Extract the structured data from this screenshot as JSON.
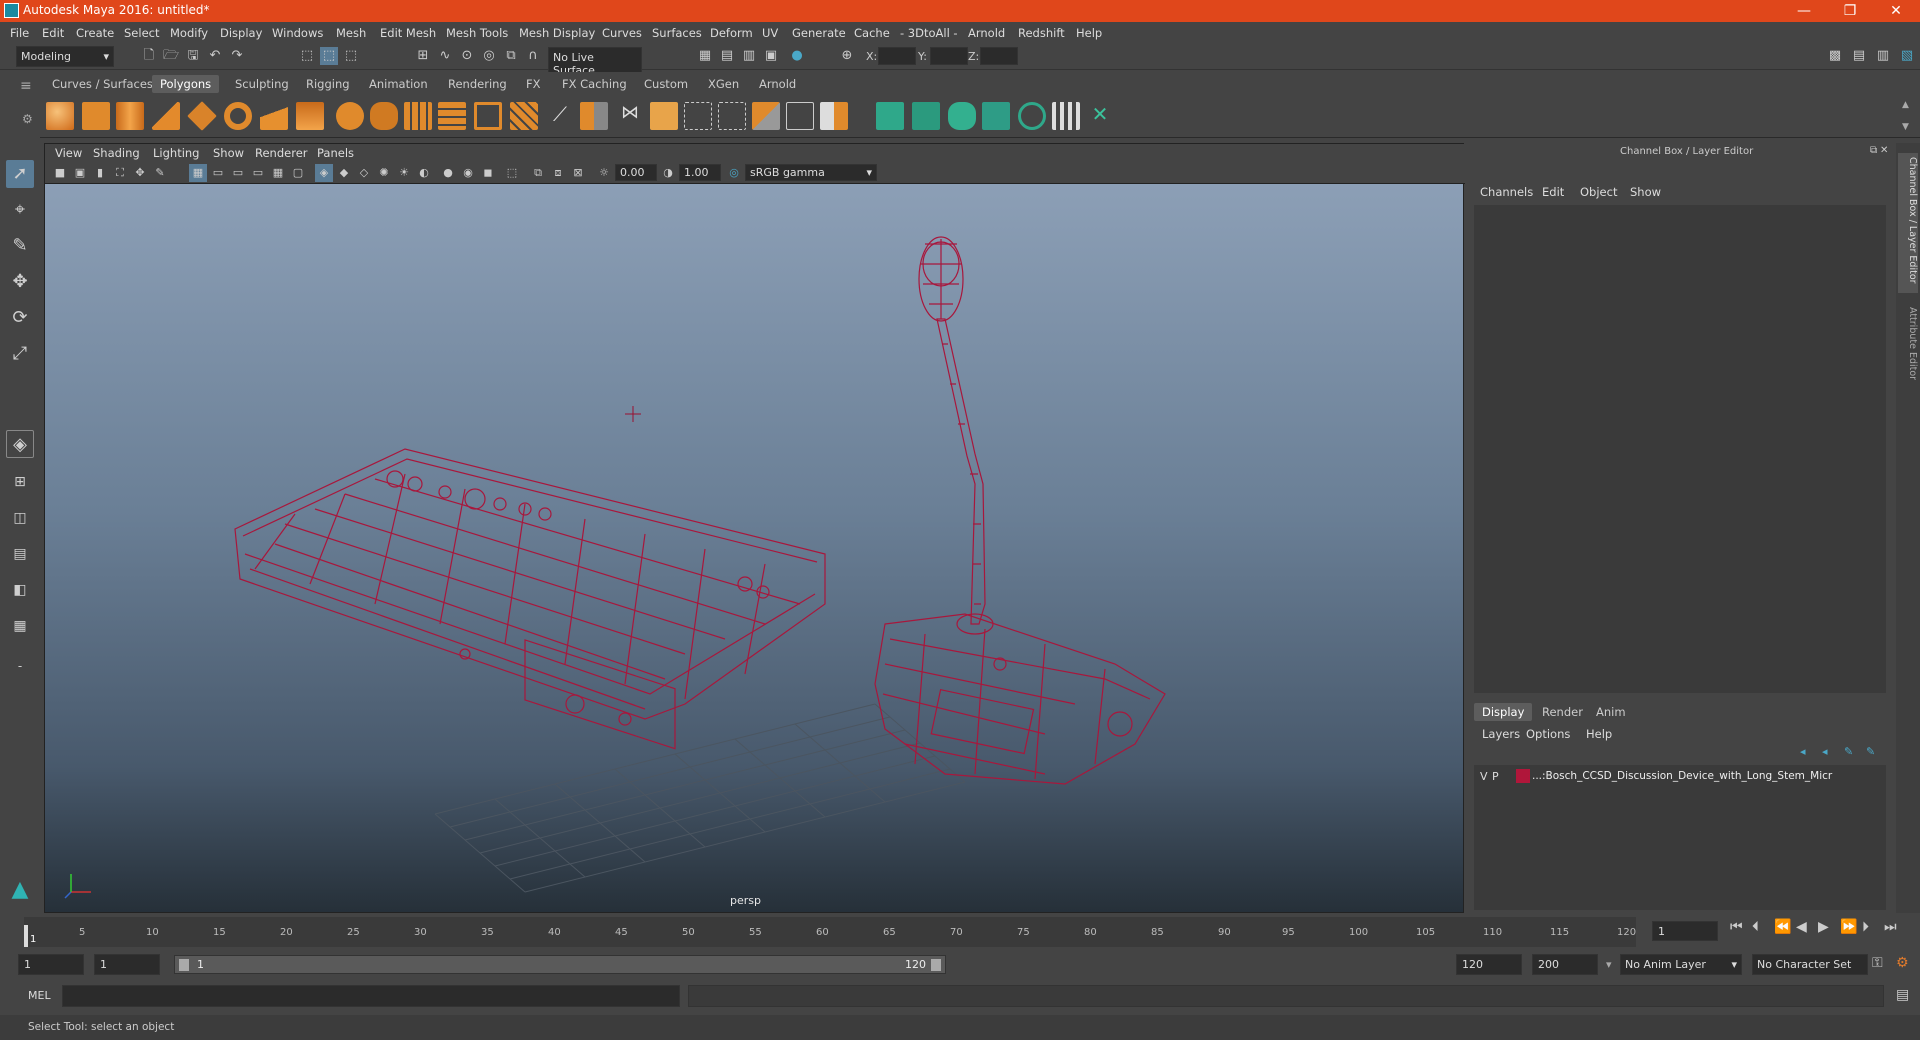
{
  "window": {
    "title": "Autodesk Maya 2016: untitled*",
    "minimize": "—",
    "maximize": "❐",
    "close": "✕"
  },
  "menu": [
    "File",
    "Edit",
    "Create",
    "Select",
    "Modify",
    "Display",
    "Windows",
    "Mesh",
    "Edit Mesh",
    "Mesh Tools",
    "Mesh Display",
    "Curves",
    "Surfaces",
    "Deform",
    "UV",
    "Generate",
    "Cache",
    "- 3DtoAll -",
    "Arnold",
    "Redshift",
    "Help"
  ],
  "status": {
    "mode": "Modeling",
    "live_surface": "No Live Surface",
    "x_label": "X:",
    "y_label": "Y:",
    "z_label": "Z:"
  },
  "shelf_tabs": [
    "Curves / Surfaces",
    "Polygons",
    "Sculpting",
    "Rigging",
    "Animation",
    "Rendering",
    "FX",
    "FX Caching",
    "Custom",
    "XGen",
    "Arnold"
  ],
  "shelf_active": "Polygons",
  "viewport": {
    "menu": [
      "View",
      "Shading",
      "Lighting",
      "Show",
      "Renderer",
      "Panels"
    ],
    "exposure": "0.00",
    "gamma": "1.00",
    "color_space": "sRGB gamma",
    "camera": "persp"
  },
  "channel_box": {
    "title": "Channel Box / Layer Editor",
    "menu": [
      "Channels",
      "Edit",
      "Object",
      "Show"
    ],
    "tabs": [
      "Display",
      "Render",
      "Anim"
    ],
    "active_tab": "Display",
    "layer_menu": [
      "Layers",
      "Options",
      "Help"
    ],
    "layer": {
      "v": "V",
      "p": "P",
      "name": "...:Bosch_CCSD_Discussion_Device_with_Long_Stem_Micr",
      "color": "#b0163a"
    }
  },
  "side_tabs": [
    "Channel Box / Layer Editor",
    "Attribute Editor"
  ],
  "timeline": {
    "ticks": [
      "5",
      "10",
      "15",
      "20",
      "25",
      "30",
      "35",
      "40",
      "45",
      "50",
      "55",
      "60",
      "65",
      "70",
      "75",
      "80",
      "85",
      "90",
      "95",
      "100",
      "105",
      "110",
      "115",
      "120"
    ],
    "start_marker": "1",
    "current": "1"
  },
  "range": {
    "start": "1",
    "anim_start": "1",
    "slider_start": "1",
    "slider_end": "120",
    "end": "120",
    "anim_end": "200",
    "anim_layer": "No Anim Layer",
    "character_set": "No Character Set"
  },
  "cmd": {
    "label": "MEL"
  },
  "help_line": "Select Tool: select an object",
  "colors": {
    "wire": "#a8173c",
    "title": "#e0471b",
    "accent": "#4aa8c8"
  }
}
